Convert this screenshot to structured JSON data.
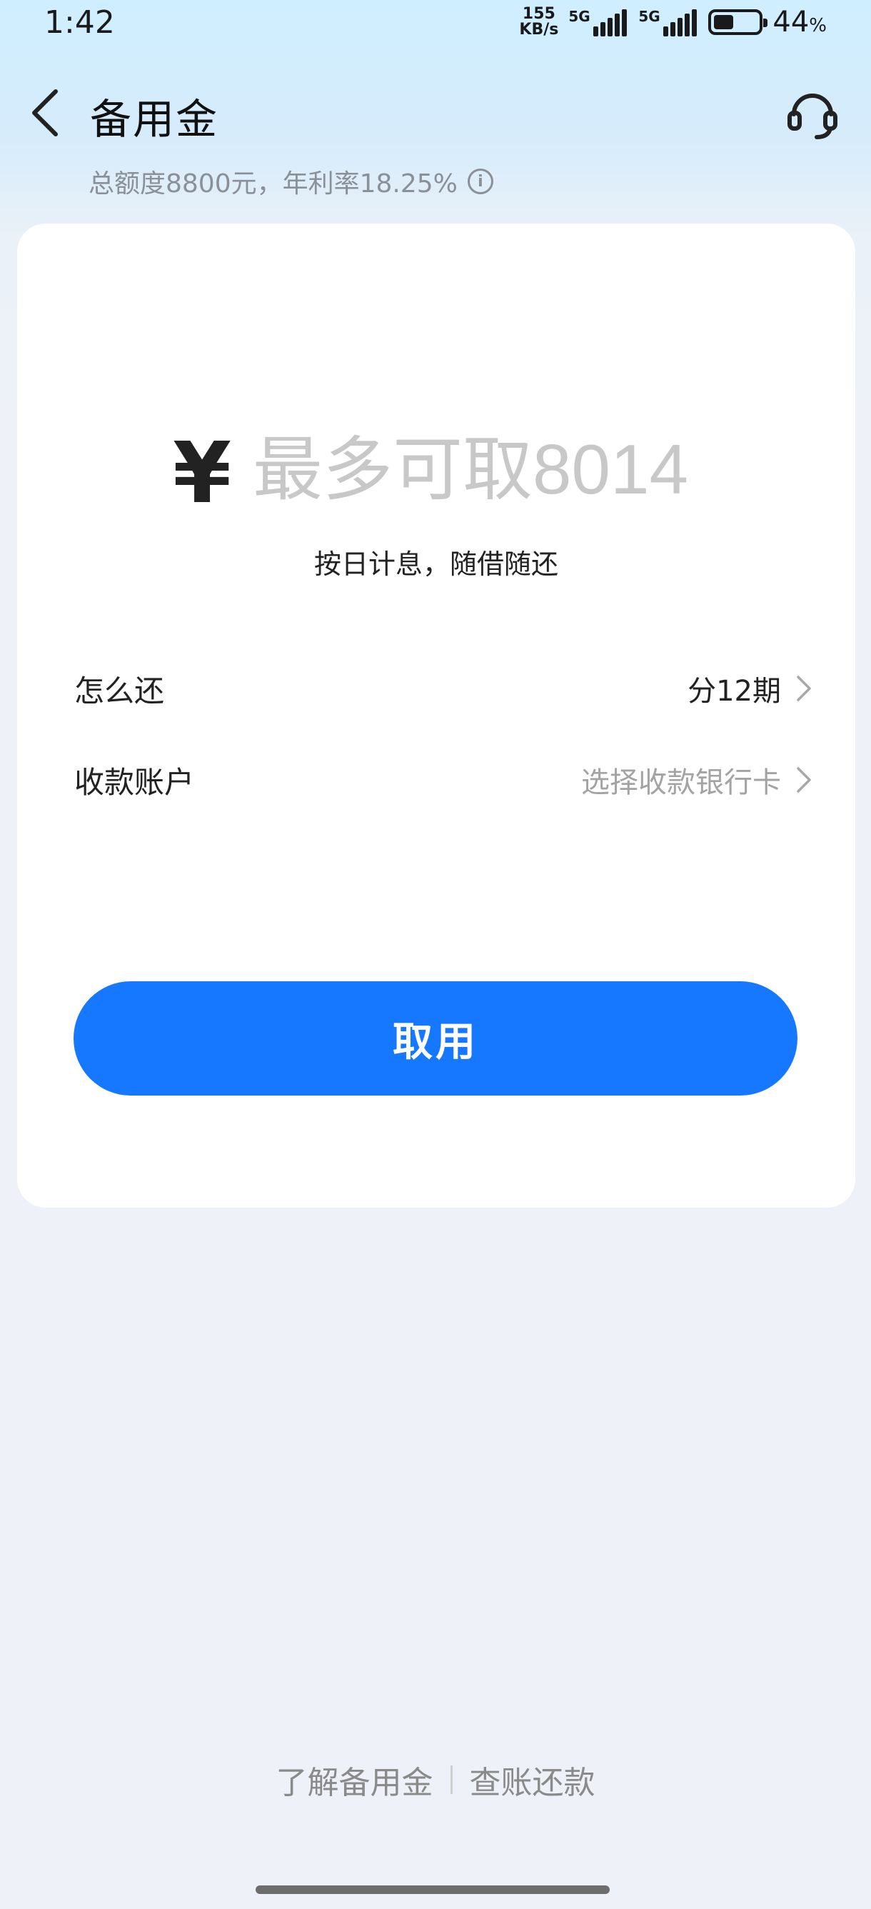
{
  "status_bar": {
    "time": "1:42",
    "net_speed_value": "155",
    "net_speed_unit": "KB/s",
    "signal_label_1": "5G",
    "signal_label_2": "5G",
    "battery_percent": "44",
    "battery_percent_sign": "%",
    "battery_level": 0.44
  },
  "header": {
    "back_icon": "chevron-left-icon",
    "title": "备用金",
    "support_icon": "headset-icon"
  },
  "subtitle": {
    "text": "总额度8800元，年利率18.25%",
    "info_icon": "info-icon",
    "info_glyph": "i"
  },
  "card": {
    "currency_symbol": "¥",
    "amount_placeholder": "最多可取8014",
    "amount_value": "",
    "interest_note": "按日计息，随借随还",
    "rows": [
      {
        "label": "怎么还",
        "value": "分12期"
      },
      {
        "label": "收款账户",
        "value": "选择收款银行卡"
      }
    ],
    "submit_label": "取用"
  },
  "footer": {
    "link_learn": "了解备用金",
    "link_bills": "查账还款"
  },
  "colors": {
    "primary": "#1677ff",
    "placeholder": "#c8c8c8",
    "muted_text": "#8a9097"
  }
}
